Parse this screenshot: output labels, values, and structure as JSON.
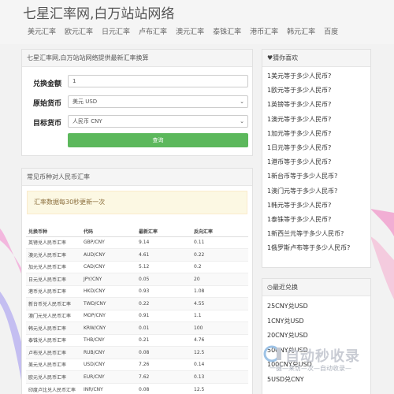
{
  "header": {
    "site_title": "七星汇率网,白万站站网络",
    "nav": [
      "美元汇率",
      "欧元汇率",
      "日元汇率",
      "卢布汇率",
      "澳元汇率",
      "泰铢汇率",
      "港币汇率",
      "韩元汇率",
      "百度"
    ]
  },
  "converter": {
    "heading": "七星汇率网,白万站站网络提供最新汇率换算",
    "amount_label": "兑换金额",
    "amount_value": "1",
    "source_label": "原始货币",
    "source_value": "美元 USD",
    "target_label": "目标货币",
    "target_value": "人民币 CNY",
    "query_label": "查询"
  },
  "common": {
    "heading": "常见币种对人民币汇率",
    "notice": "汇率数据每30秒更新一次",
    "columns": [
      "兑换币种",
      "代码",
      "最新汇率",
      "反向汇率"
    ],
    "rows": [
      [
        "英镑兑人民币汇率",
        "GBP/CNY",
        "9.14",
        "0.11"
      ],
      [
        "澳元兑人民币汇率",
        "AUD/CNY",
        "4.61",
        "0.22"
      ],
      [
        "加元兑人民币汇率",
        "CAD/CNY",
        "5.12",
        "0.2"
      ],
      [
        "日元兑人民币汇率",
        "JPY/CNY",
        "0.05",
        "20"
      ],
      [
        "港币兑人民币汇率",
        "HKD/CNY",
        "0.93",
        "1.08"
      ],
      [
        "新台币兑人民币汇率",
        "TWD/CNY",
        "0.22",
        "4.55"
      ],
      [
        "澳门元兑人民币汇率",
        "MOP/CNY",
        "0.91",
        "1.1"
      ],
      [
        "韩元兑人民币汇率",
        "KRW/CNY",
        "0.01",
        "100"
      ],
      [
        "泰铢兑人民币汇率",
        "THB/CNY",
        "0.21",
        "4.76"
      ],
      [
        "卢布兑人民币汇率",
        "RUB/CNY",
        "0.08",
        "12.5"
      ],
      [
        "美元兑人民币汇率",
        "USD/CNY",
        "7.26",
        "0.14"
      ],
      [
        "欧元兑人民币汇率",
        "EUR/CNY",
        "7.62",
        "0.13"
      ],
      [
        "印度卢比兑人民币汇率",
        "INR/CNY",
        "0.08",
        "12.5"
      ]
    ]
  },
  "guess": {
    "heading": "猜你喜欢",
    "items": [
      "1美元等于多少人民币?",
      "1欧元等于多少人民币?",
      "1英镑等于多少人民币?",
      "1澳元等于多少人民币?",
      "1加元等于多少人民币?",
      "1日元等于多少人民币?",
      "1港币等于多少人民币?",
      "1新台币等于多少人民币?",
      "1澳门元等于多少人民币?",
      "1韩元等于多少人民币?",
      "1泰铢等于多少人民币?",
      "1新西兰元等于多少人民币?",
      "1俄罗斯卢布等于多少人民币?"
    ]
  },
  "recent": {
    "heading": "最近兑换",
    "items": [
      "25CNY兑USD",
      "1CNY兑USD",
      "20CNY兑USD",
      "50CNY兑USD",
      "100CNY兑USD",
      "5USD兑CNY"
    ]
  },
  "watermark": {
    "title": "自动秒收录",
    "subtitle": "一键—来访—次—自动收录—"
  },
  "colors": {
    "accent_green": "#5cb85c",
    "notice_bg": "#fcf8e3",
    "notice_text": "#8a6d3b"
  }
}
